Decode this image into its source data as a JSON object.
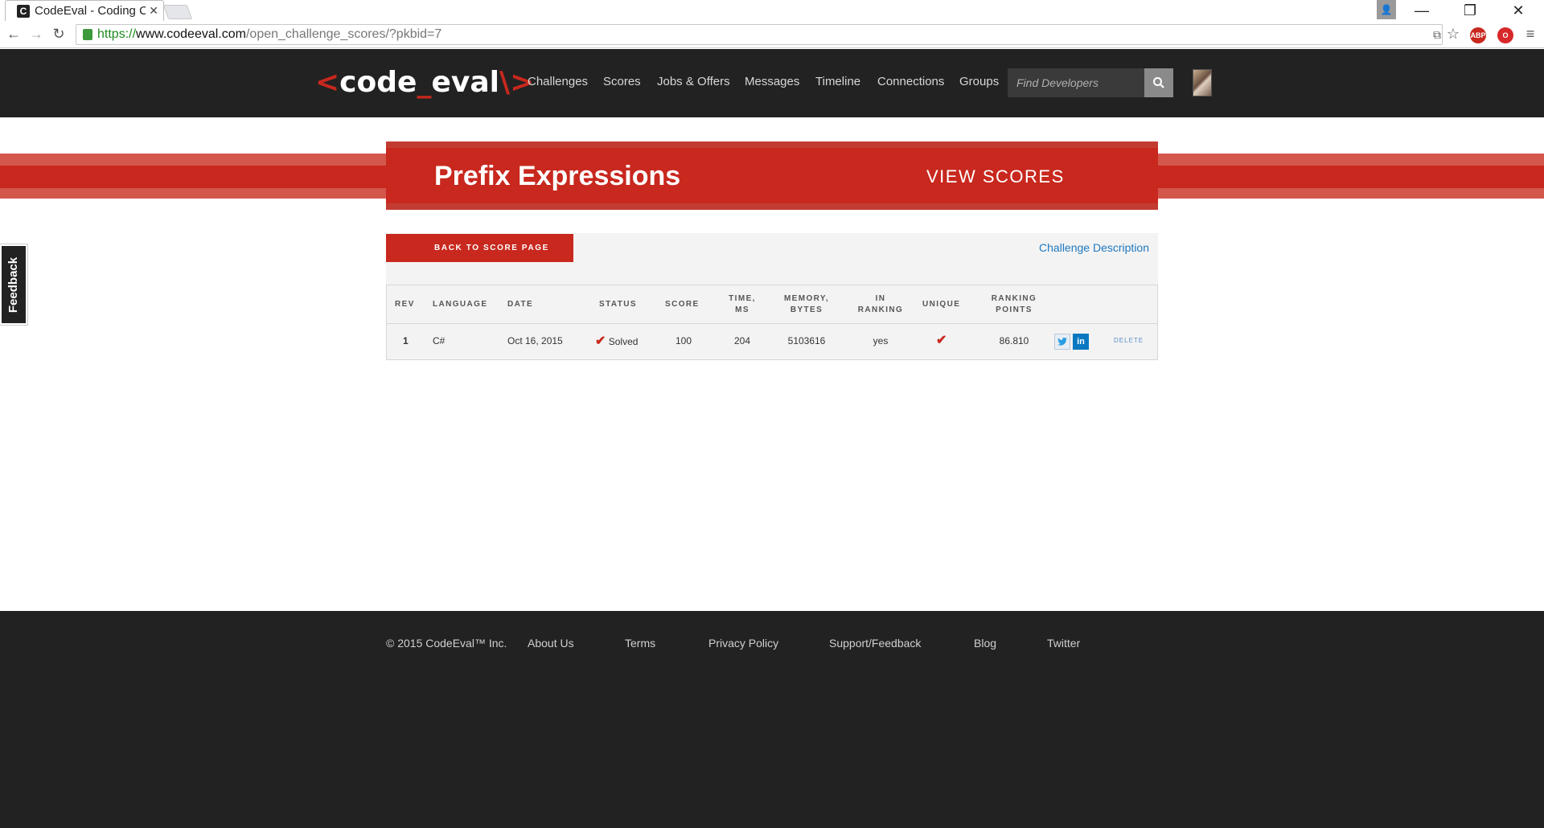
{
  "browser": {
    "tab_title": "CodeEval - Coding C",
    "favicon_letter": "C",
    "url_scheme": "https://",
    "url_host": "www.codeeval.com",
    "url_path": "/open_challenge_scores/?pkbid=7",
    "extensions": [
      "ABP",
      "opera-icon"
    ]
  },
  "header": {
    "logo": {
      "open": "<",
      "word_a": "code",
      "underscore": "_",
      "word_b": "eval",
      "close": "\\>"
    },
    "nav": [
      "Challenges",
      "Scores",
      "Jobs & Offers",
      "Messages",
      "Timeline",
      "Connections",
      "Groups"
    ],
    "search_placeholder": "Find Developers"
  },
  "banner": {
    "title": "Prefix Expressions",
    "view_scores": "VIEW SCORES"
  },
  "feedback": "Feedback",
  "scores": {
    "back_button": "BACK TO SCORE PAGE",
    "challenge_description": "Challenge Description",
    "columns": {
      "rev": "REV",
      "language": "LANGUAGE",
      "date": "DATE",
      "status": "STATUS",
      "score": "SCORE",
      "time_a": "TIME,",
      "time_b": "MS",
      "memory_a": "MEMORY,",
      "memory_b": "BYTES",
      "ranking_a": "IN",
      "ranking_b": "RANKING",
      "unique": "UNIQUE",
      "points_a": "RANKING",
      "points_b": "POINTS"
    },
    "rows": [
      {
        "rev": "1",
        "language": "C#",
        "date": "Oct 16, 2015",
        "status": "Solved",
        "score": "100",
        "time": "204",
        "memory": "5103616",
        "in_ranking": "yes",
        "unique": true,
        "points": "86.810",
        "delete": "DELETE"
      }
    ]
  },
  "footer": {
    "copyright": "© 2015 CodeEval™ Inc.",
    "links": [
      "About Us",
      "Terms",
      "Privacy Policy",
      "Support/Feedback",
      "Blog",
      "Twitter"
    ]
  },
  "colors": {
    "brand_red": "#c8281e",
    "dark": "#222222",
    "link_blue": "#1f78c0"
  }
}
